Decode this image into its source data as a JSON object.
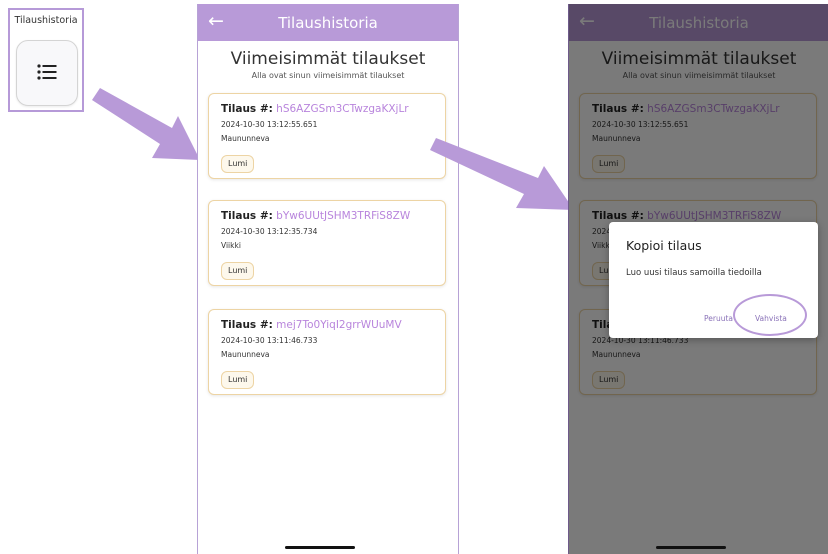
{
  "tile": {
    "title": "Tilaushistoria",
    "icon": "list-icon"
  },
  "app": {
    "title": "Tilaushistoria",
    "back_icon": "←",
    "heading": "Viimeisimmät tilaukset",
    "subheading": "Alla ovat sinun viimeisimmät tilaukset",
    "order_label": "Tilaus #:"
  },
  "orders": [
    {
      "id": "hS6AZGSm3CTwzgaKXjLr",
      "date": "2024-10-30 13:12:55.651",
      "location": "Maununneva",
      "tag": "Lumi"
    },
    {
      "id": "bYw6UUtJSHM3TRFiS8ZW",
      "date": "2024-10-30 13:12:35.734",
      "location": "Viikki",
      "tag": "Lumi"
    },
    {
      "id": "mej7To0YiqI2grrWUuMV",
      "date": "2024-10-30 13:11:46.733",
      "location": "Maununneva",
      "tag": "Lumi"
    }
  ],
  "dialog": {
    "title": "Kopioi tilaus",
    "body": "Luo uusi tilaus samoilla tiedoilla",
    "cancel": "Peruuta",
    "confirm": "Vahvista"
  },
  "colors": {
    "accent": "#b89ad8",
    "order_id": "#b884dc",
    "card_border": "#edd4a4"
  }
}
